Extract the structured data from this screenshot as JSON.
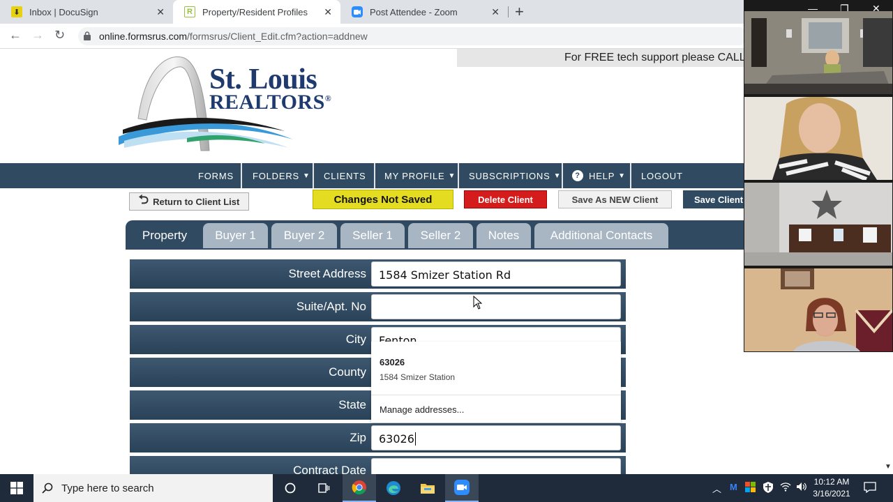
{
  "browser": {
    "tabs": [
      {
        "title": "Inbox | DocuSign",
        "icon": "download-icon"
      },
      {
        "title": "Property/Resident Profiles",
        "icon": "formsrus-icon"
      },
      {
        "title": "Post Attendee - Zoom",
        "icon": "zoom-icon"
      }
    ],
    "url_host": "online.formsrus.com",
    "url_path": "/formsrus/Client_Edit.cfm?action=addnew"
  },
  "page": {
    "support_text": "For FREE tech support please CALL",
    "logo": {
      "line1": "St. Louis",
      "line2": "REALTORS",
      "mark": "®"
    },
    "nav": {
      "forms": "FORMS",
      "folders": "FOLDERS",
      "clients": "CLIENTS",
      "my_profile": "MY PROFILE",
      "subscriptions": "SUBSCRIPTIONS",
      "help": "HELP",
      "logout": "LOGOUT"
    },
    "actions": {
      "return": "Return to Client List",
      "not_saved": "Changes Not Saved",
      "delete": "Delete Client",
      "save_as_new": "Save As NEW Client",
      "save": "Save Client"
    },
    "tabs": [
      "Property",
      "Buyer 1",
      "Buyer 2",
      "Seller 1",
      "Seller 2",
      "Notes",
      "Additional Contacts"
    ],
    "fields": [
      {
        "label": "Street Address",
        "value": "1584 Smizer Station Rd"
      },
      {
        "label": "Suite/Apt. No",
        "value": ""
      },
      {
        "label": "City",
        "value": "Fenton"
      },
      {
        "label": "County",
        "value": ""
      },
      {
        "label": "State",
        "value": ""
      },
      {
        "label": "Zip",
        "value": "63026"
      },
      {
        "label": "Contract Date",
        "value": ""
      }
    ],
    "autocomplete": {
      "main": "63026",
      "sub": "1584 Smizer Station",
      "manage": "Manage addresses..."
    }
  },
  "taskbar": {
    "search_placeholder": "Type here to search",
    "time": "10:12 AM",
    "date": "3/16/2021"
  },
  "colors": {
    "nav_bg": "#2f4a61",
    "not_saved": "#e4dc21",
    "delete": "#d51c1c",
    "logo_blue": "#1e3a6e"
  }
}
